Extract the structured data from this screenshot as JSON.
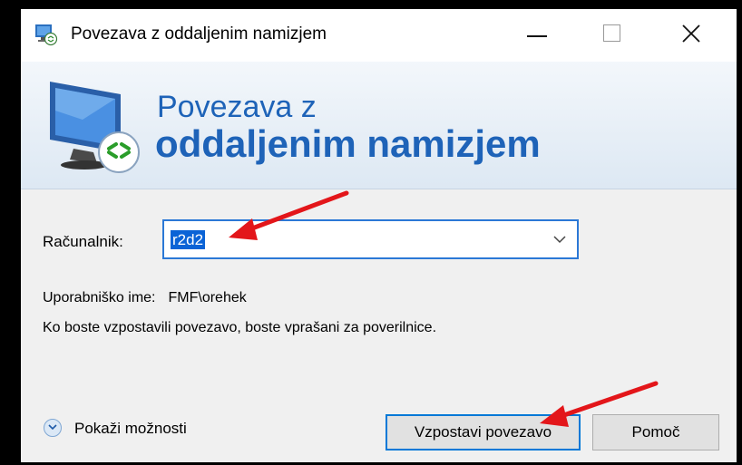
{
  "window": {
    "title": "Povezava z oddaljenim namizjem",
    "icon": "remote-desktop-icon",
    "controls": [
      "minimize-icon",
      "maximize-icon",
      "close-icon"
    ]
  },
  "banner": {
    "line1": "Povezava z",
    "line2": "oddaljenim namizjem",
    "icon": "remote-desktop-monitor-icon",
    "title_color": "#1e63b8"
  },
  "form": {
    "computer_label": "Računalnik:",
    "computer_value": "r2d2",
    "username_label": "Uporabniško ime:",
    "username_value": "FMF\\orehek",
    "note": "Ko boste vzpostavili povezavo, boste vprašani za poverilnice."
  },
  "footer": {
    "options_label": "Pokaži možnosti",
    "connect_label": "Vzpostavi povezavo",
    "help_label": "Pomoč"
  },
  "annotations": {
    "arrow_color": "#e3161a"
  }
}
